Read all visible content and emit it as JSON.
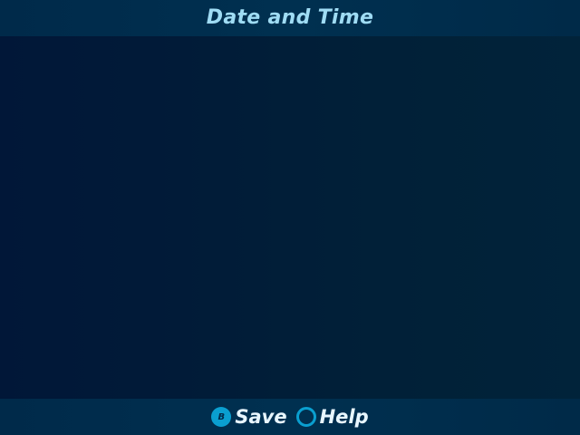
{
  "header": {
    "title": "Date and Time"
  },
  "footer": {
    "hints": [
      {
        "glyph": "B",
        "label": "Save",
        "icon": "b-button-icon"
      },
      {
        "glyph": "",
        "label": "Help",
        "icon": "circle-button-icon"
      }
    ]
  },
  "colors": {
    "bar_background": "#003050",
    "content_background": "#011d38",
    "title_text": "#9fdcf4",
    "accent": "#0a9fd0",
    "hint_text": "#e8f6ff"
  }
}
